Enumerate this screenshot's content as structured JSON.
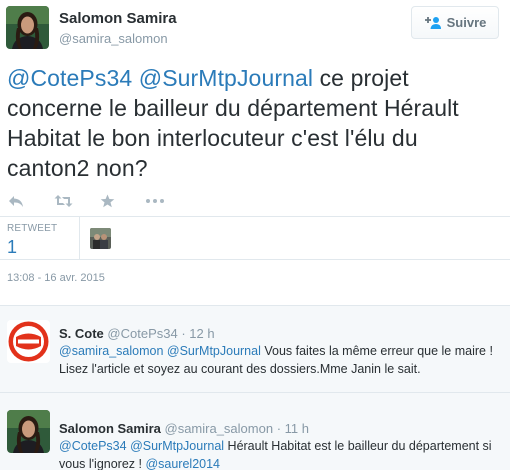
{
  "main_tweet": {
    "author_name": "Salomon Samira",
    "author_handle": "@samira_salomon",
    "follow_label": "Suivre",
    "text_mention_1": "@CotePs34",
    "text_mention_2": "@SurMtpJournal",
    "text_body": " ce projet concerne le bailleur du département Hérault Habitat le bon interlocuteur c'est l'élu du canton2 non?",
    "actions": [
      "reply-icon",
      "retweet-icon",
      "favorite-icon",
      "more-icon"
    ],
    "stats": {
      "retweet_label": "RETWEET",
      "retweet_count": "1"
    },
    "timestamp": "13:08 - 16 avr. 2015"
  },
  "replies": [
    {
      "name": "S. Cote",
      "handle": "@CotePs34",
      "time": "· 12 h",
      "mention_1": "@samira_salomon",
      "mention_2": "@SurMtpJournal",
      "text": " Vous faites la même erreur que le maire ! Lisez l'article et soyez au courant des dossiers.Mme Janin le sait."
    },
    {
      "name": "Salomon Samira",
      "handle": "@samira_salomon",
      "time": "· 11 h",
      "mention_1": "@CotePs34",
      "mention_2": "@SurMtpJournal",
      "text": " Hérault Habitat est le bailleur du département si vous l'ignorez ! ",
      "mention_3": "@saurel2014"
    }
  ],
  "colors": {
    "link": "#2b7bb9",
    "muted": "#8899a6",
    "text": "#292f33",
    "border": "#e1e8ed",
    "reply_bg": "#f5f8fa"
  }
}
